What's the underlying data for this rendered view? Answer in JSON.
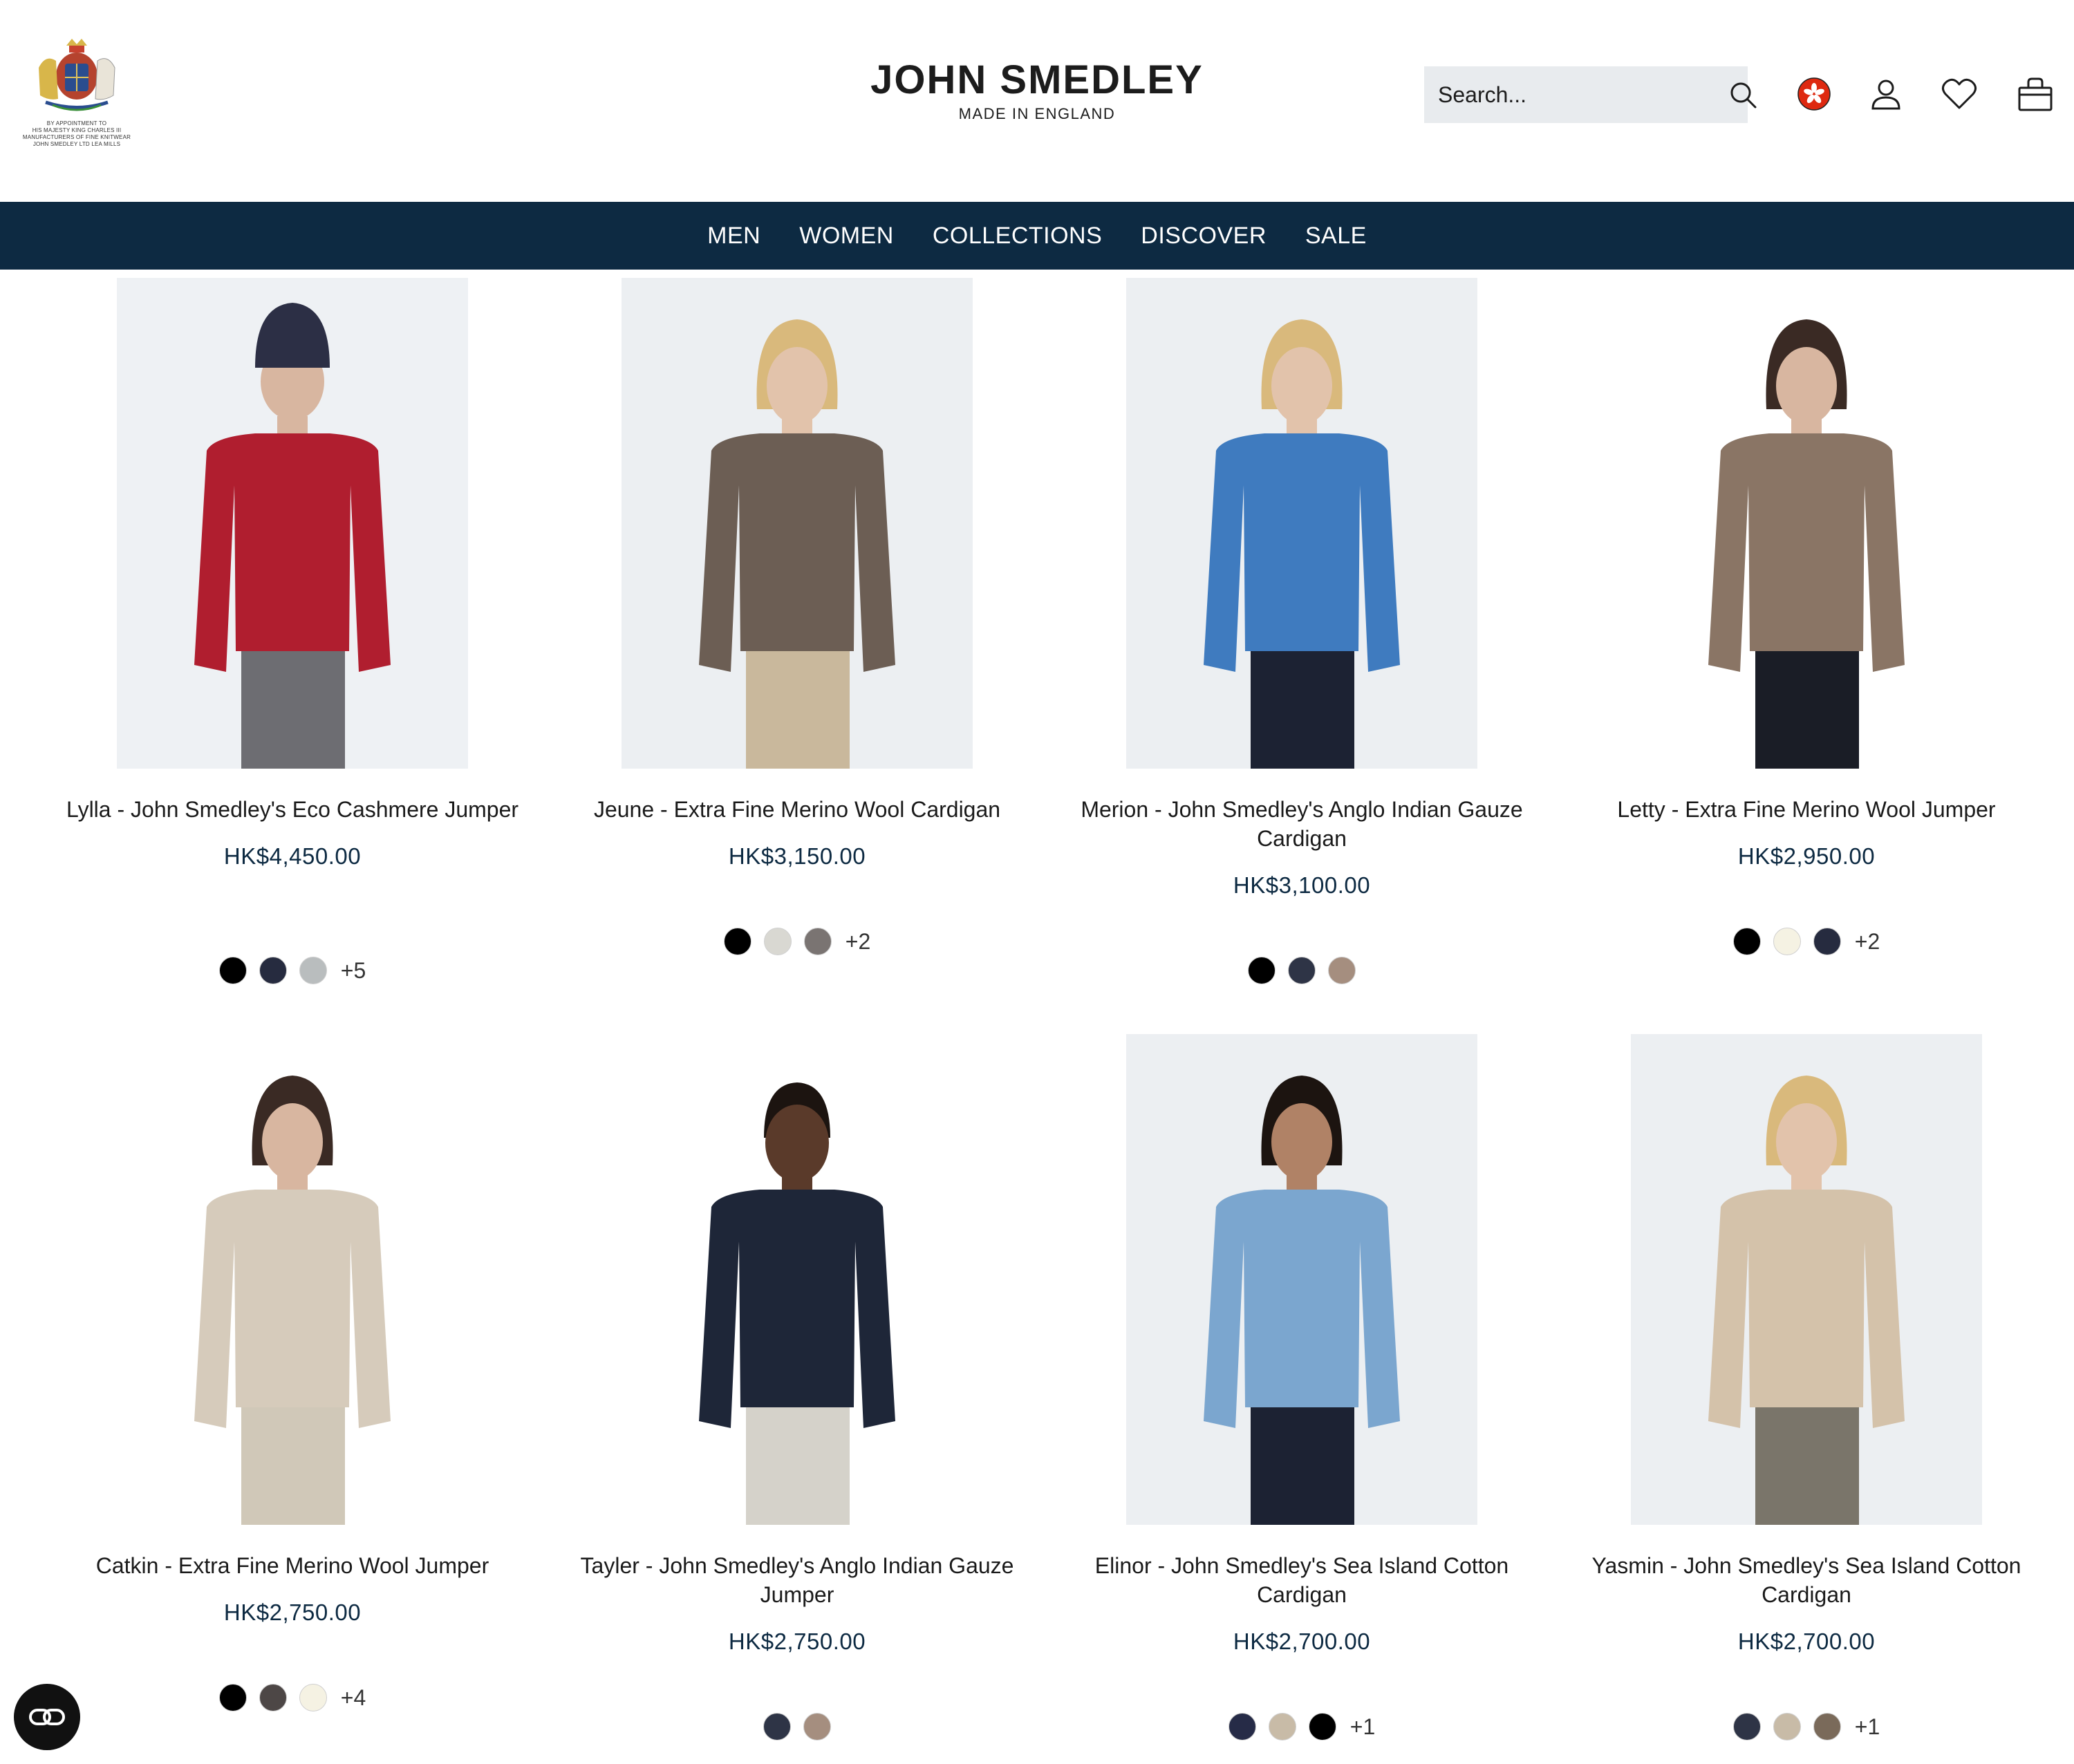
{
  "header": {
    "crest_lines": [
      "BY APPOINTMENT TO",
      "HIS MAJESTY KING CHARLES III",
      "MANUFACTURERS OF FINE KNITWEAR",
      "JOHN SMEDLEY LTD LEA MILLS"
    ],
    "brand_name": "JOHN SMEDLEY",
    "brand_tagline": "MADE IN ENGLAND",
    "search_placeholder": "Search..."
  },
  "nav": {
    "items": [
      "MEN",
      "WOMEN",
      "COLLECTIONS",
      "DISCOVER",
      "SALE"
    ]
  },
  "colors": {
    "nav_bg": "#0d2a42",
    "price": "#0d2a42",
    "search_bg": "#e8ebee"
  },
  "products": [
    {
      "name": "Lylla - John Smedley's Eco Cashmere Jumper",
      "price": "HK$4,450.00",
      "swatches": [
        "#000000",
        "#262b3f",
        "#b9bdbe"
      ],
      "more": "+5"
    },
    {
      "name": "Jeune - Extra Fine Merino Wool Cardigan",
      "price": "HK$3,150.00",
      "swatches": [
        "#000000",
        "#d9d8d2",
        "#7a7472"
      ],
      "more": "+2"
    },
    {
      "name": "Merion - John Smedley's Anglo Indian Gauze Cardigan",
      "price": "HK$3,100.00",
      "swatches": [
        "#000000",
        "#2e3446",
        "#a58e7f"
      ],
      "more": ""
    },
    {
      "name": "Letty - Extra Fine Merino Wool Jumper",
      "price": "HK$2,950.00",
      "swatches": [
        "#000000",
        "#f5f2e3",
        "#262b3f"
      ],
      "more": "+2"
    },
    {
      "name": "Catkin - Extra Fine Merino Wool Jumper",
      "price": "HK$2,750.00",
      "swatches": [
        "#000000",
        "#4d4746",
        "#f5f2e3"
      ],
      "more": "+4"
    },
    {
      "name": "Tayler - John Smedley's Anglo Indian Gauze Jumper",
      "price": "HK$2,750.00",
      "swatches": [
        "#2e3446",
        "#a58e7f"
      ],
      "more": ""
    },
    {
      "name": "Elinor - John Smedley's Sea Island Cotton Cardigan",
      "price": "HK$2,700.00",
      "swatches": [
        "#262b47",
        "#c8bba7",
        "#000000"
      ],
      "more": "+1"
    },
    {
      "name": "Yasmin - John Smedley's Sea Island Cotton Cardigan",
      "price": "HK$2,700.00",
      "swatches": [
        "#2e3446",
        "#c8bba7",
        "#7a6a5a"
      ],
      "more": "+1"
    }
  ]
}
